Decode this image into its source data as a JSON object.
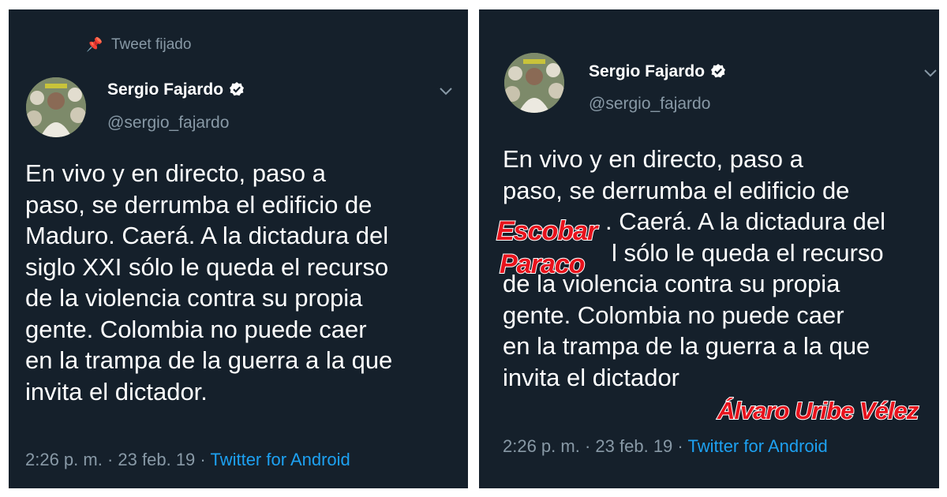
{
  "colors": {
    "background": "#15202b",
    "text": "#ffffff",
    "muted": "#8899a6",
    "link": "#1da1f2",
    "overlay_red": "#e8121c"
  },
  "left_tweet": {
    "pinned_label": "Tweet fijado",
    "pinned_icon": "pin-icon",
    "author_name": "Sergio Fajardo",
    "handle": "@sergio_fajardo",
    "verified_icon": "verified-badge-icon",
    "menu_icon": "chevron-down-icon",
    "text_lines": [
      "En vivo y en directo, paso a",
      "paso, se derrumba el edificio de",
      "Maduro. Caerá. A la  dictadura del",
      "siglo XXI sólo le queda el recurso",
      "de la violencia contra su propia",
      "gente. Colombia no puede caer",
      "en la trampa de la guerra a la que",
      "invita el dictador."
    ],
    "time": "2:26 p. m.",
    "separator": "·",
    "date": "23 feb. 19",
    "source": "Twitter for Android"
  },
  "right_tweet": {
    "author_name": "Sergio Fajardo",
    "handle": "@sergio_fajardo",
    "verified_icon": "verified-badge-icon",
    "menu_icon": "chevron-down-icon",
    "text_lines": [
      "En vivo y en directo, paso a",
      "paso, se derrumba el edificio de",
      ". Caerá. A la  dictadura del",
      "l sólo le queda el recurso",
      "de la violencia contra su propia",
      "gente. Colombia no puede caer",
      "en la trampa de la guerra a la que",
      "invita el dictador"
    ],
    "overlay_words": [
      "Escobar",
      "Paraco",
      "Álvaro Uribe Vélez"
    ],
    "time": "2:26 p. m.",
    "separator": "·",
    "date": "23 feb. 19",
    "source": "Twitter for Android"
  }
}
